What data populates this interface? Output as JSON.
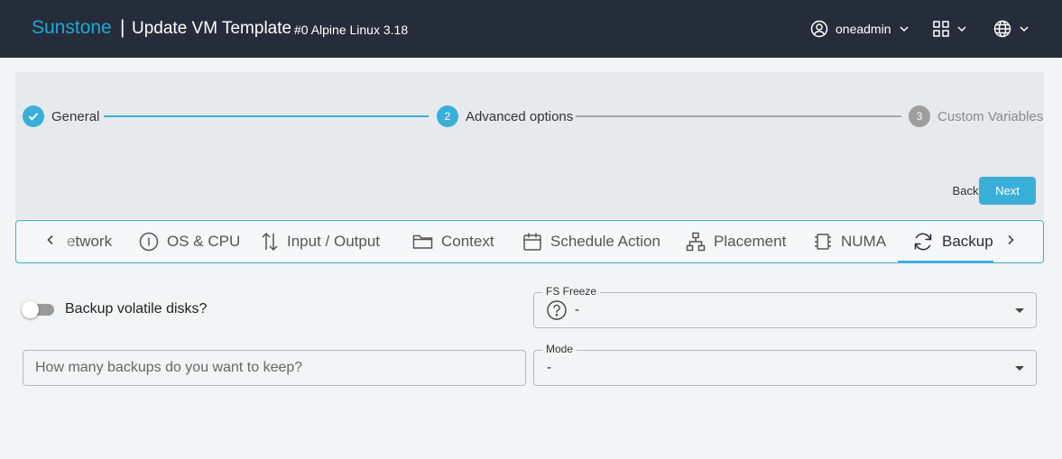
{
  "header": {
    "brand": "Sunstone",
    "separator": "|",
    "title": "Update VM Template",
    "subtitle": "#0 Alpine Linux 3.18",
    "user": "oneadmin",
    "icons": [
      "user-circle-icon",
      "chevron-down-icon",
      "apps-grid-icon",
      "globe-icon"
    ]
  },
  "stepper": {
    "steps": [
      {
        "label": "General",
        "marker": "✓",
        "state": "completed"
      },
      {
        "label": "Advanced options",
        "marker": "2",
        "state": "active"
      },
      {
        "label": "Custom Variables",
        "marker": "3",
        "state": "pending"
      }
    ],
    "back_label": "Back",
    "next_label": "Next",
    "colors": {
      "accent": "#3aafd8",
      "inactive": "#9e9e9e"
    }
  },
  "tabs": {
    "items": [
      {
        "label": "etwork",
        "icon": "network-icon"
      },
      {
        "label": "OS & CPU",
        "icon": "info-circle-icon"
      },
      {
        "label": "Input / Output",
        "icon": "input-output-arrows-icon"
      },
      {
        "label": "Context",
        "icon": "folder-icon"
      },
      {
        "label": "Schedule Action",
        "icon": "calendar-icon"
      },
      {
        "label": "Placement",
        "icon": "hierarchy-icon"
      },
      {
        "label": "NUMA",
        "icon": "chip-icon"
      },
      {
        "label": "Backup",
        "icon": "refresh-icon",
        "active": true
      }
    ]
  },
  "form": {
    "backup_volatile_label": "Backup volatile disks?",
    "backup_volatile_enabled": false,
    "fs_freeze": {
      "label": "FS Freeze",
      "value": "-"
    },
    "keep_backups": {
      "placeholder": "How many backups do you want to keep?",
      "value": ""
    },
    "mode": {
      "label": "Mode",
      "value": "-"
    }
  }
}
